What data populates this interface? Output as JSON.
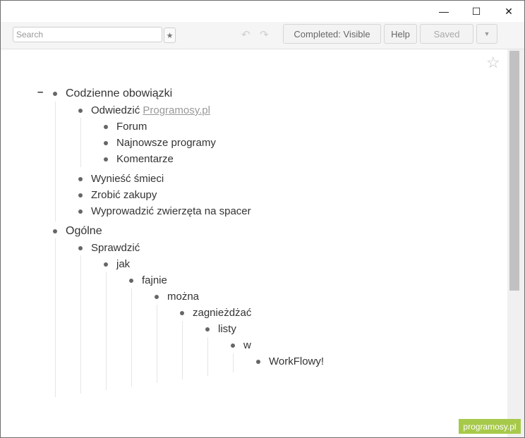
{
  "window": {
    "min_glyph": "—",
    "max_glyph": "☐",
    "close_glyph": "✕"
  },
  "toolbar": {
    "search_placeholder": "Search",
    "star_glyph": "★",
    "undo_glyph": "↶",
    "redo_glyph": "↷",
    "completed_label": "Completed: Visible",
    "help_label": "Help",
    "saved_label": "Saved",
    "more_glyph": "▼"
  },
  "outline": {
    "collapse_glyph": "–",
    "fav_star_glyph": "☆",
    "items": [
      "Codzienne obowiązki",
      "Odwiedzić ",
      "Programosy.pl",
      "Forum",
      "Najnowsze programy",
      "Komentarze",
      "Wynieść śmieci",
      "Zrobić zakupy",
      "Wyprowadzić zwierzęta na spacer",
      "Ogólne",
      "Sprawdzić",
      "jak",
      "fajnie",
      "można",
      "zagnieżdżać",
      "listy",
      "w",
      "WorkFlowy!"
    ]
  },
  "watermark": "programosy.pl"
}
